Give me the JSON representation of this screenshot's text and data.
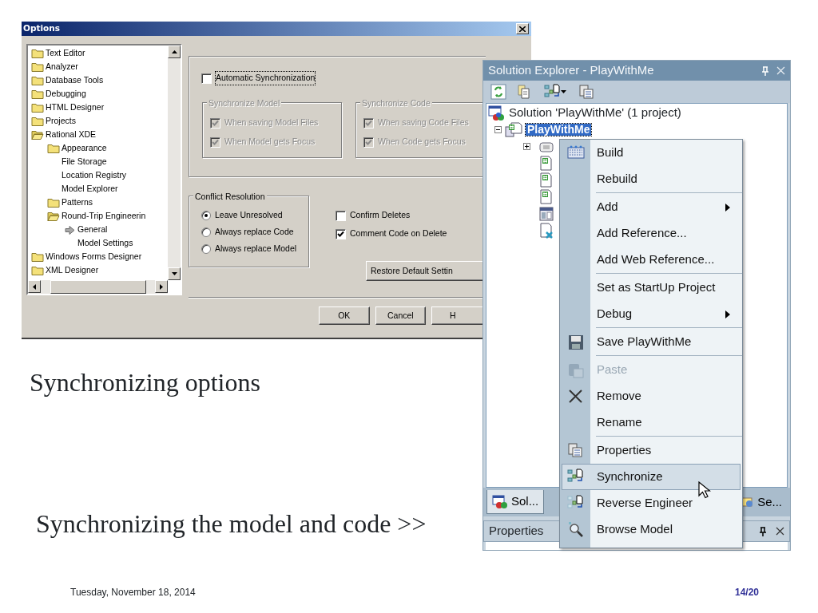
{
  "options_dialog": {
    "title": "Options",
    "tree": [
      {
        "label": "Text Editor",
        "kind": "folder"
      },
      {
        "label": "Analyzer",
        "kind": "folder"
      },
      {
        "label": "Database Tools",
        "kind": "folder"
      },
      {
        "label": "Debugging",
        "kind": "folder"
      },
      {
        "label": "HTML Designer",
        "kind": "folder"
      },
      {
        "label": "Projects",
        "kind": "folder"
      },
      {
        "label": "Rational XDE",
        "kind": "open",
        "children": [
          {
            "label": "Appearance",
            "kind": "folder"
          },
          {
            "label": "File Storage",
            "kind": "page"
          },
          {
            "label": "Location Registry",
            "kind": "page"
          },
          {
            "label": "Model Explorer",
            "kind": "page"
          },
          {
            "label": "Patterns",
            "kind": "folder"
          },
          {
            "label": "Round-Trip Engineerin",
            "kind": "open",
            "children": [
              {
                "label": "General",
                "kind": "current"
              },
              {
                "label": "Model Settings",
                "kind": "page"
              }
            ]
          }
        ]
      },
      {
        "label": "Windows Forms Designer",
        "kind": "folder"
      },
      {
        "label": "XML Designer",
        "kind": "folder"
      }
    ],
    "auto_sync": {
      "label": "Automatic Synchronization",
      "checked": false,
      "focused": true
    },
    "groups": [
      {
        "title": "Synchronize Model",
        "disabled": true,
        "options": [
          {
            "label": "When saving Model Files",
            "checked": true
          },
          {
            "label": "When Model gets Focus",
            "checked": true
          }
        ]
      },
      {
        "title": "Synchronize Code",
        "disabled": true,
        "options": [
          {
            "label": "When saving Code Files",
            "checked": true
          },
          {
            "label": "When Code gets Focus",
            "checked": true
          }
        ]
      }
    ],
    "conflict": {
      "title": "Conflict Resolution",
      "options": [
        {
          "label": "Leave Unresolved",
          "selected": true
        },
        {
          "label": "Always replace Code",
          "selected": false
        },
        {
          "label": "Always replace Model",
          "selected": false
        }
      ]
    },
    "checks": [
      {
        "label": "Confirm Deletes",
        "checked": false
      },
      {
        "label": "Comment Code on Delete",
        "checked": true
      }
    ],
    "restore_button": "Restore Default Settin",
    "buttons": [
      "OK",
      "Cancel",
      "H"
    ]
  },
  "solution_explorer": {
    "title": "Solution Explorer - PlayWithMe",
    "solution": {
      "label": "Solution 'PlayWithMe' (1 project)"
    },
    "project": {
      "label": "PlayWithMe",
      "selected": true,
      "expanded": true
    },
    "tabs": [
      {
        "label": "Sol...",
        "selected": true
      },
      {
        "label": "Se...",
        "selected": false
      }
    ],
    "properties_title": "Properties"
  },
  "context_menu": {
    "items": [
      {
        "kind": "item",
        "label": "Build",
        "submenu": false,
        "disabled": false,
        "selected": false
      },
      {
        "kind": "item",
        "label": "Rebuild",
        "submenu": false,
        "disabled": false,
        "selected": false
      },
      {
        "kind": "separator"
      },
      {
        "kind": "item",
        "label": "Add",
        "submenu": true,
        "disabled": false,
        "selected": false
      },
      {
        "kind": "item",
        "label": "Add Reference...",
        "submenu": false,
        "disabled": false,
        "selected": false
      },
      {
        "kind": "item",
        "label": "Add Web Reference...",
        "submenu": false,
        "disabled": false,
        "selected": false
      },
      {
        "kind": "separator"
      },
      {
        "kind": "item",
        "label": "Set as StartUp Project",
        "submenu": false,
        "disabled": false,
        "selected": false
      },
      {
        "kind": "item",
        "label": "Debug",
        "submenu": true,
        "disabled": false,
        "selected": false
      },
      {
        "kind": "separator"
      },
      {
        "kind": "item",
        "label": "Save PlayWithMe",
        "submenu": false,
        "disabled": false,
        "selected": false
      },
      {
        "kind": "separator"
      },
      {
        "kind": "item",
        "label": "Paste",
        "submenu": false,
        "disabled": true,
        "selected": false
      },
      {
        "kind": "item",
        "label": "Remove",
        "submenu": false,
        "disabled": false,
        "selected": false
      },
      {
        "kind": "item",
        "label": "Rename",
        "submenu": false,
        "disabled": false,
        "selected": false
      },
      {
        "kind": "separator"
      },
      {
        "kind": "item",
        "label": "Properties",
        "submenu": false,
        "disabled": false,
        "selected": false
      },
      {
        "kind": "item",
        "label": "Synchronize",
        "submenu": false,
        "disabled": false,
        "selected": true
      },
      {
        "kind": "item",
        "label": "Reverse Engineer",
        "submenu": false,
        "disabled": false,
        "selected": false
      },
      {
        "kind": "item",
        "label": "Browse Model",
        "submenu": false,
        "disabled": false,
        "selected": false
      }
    ]
  },
  "slide": {
    "title": "Synchronizing options",
    "subtitle": "Synchronizing the model and code >>",
    "date": "Tuesday, November 18, 2014",
    "page": "14/20"
  }
}
